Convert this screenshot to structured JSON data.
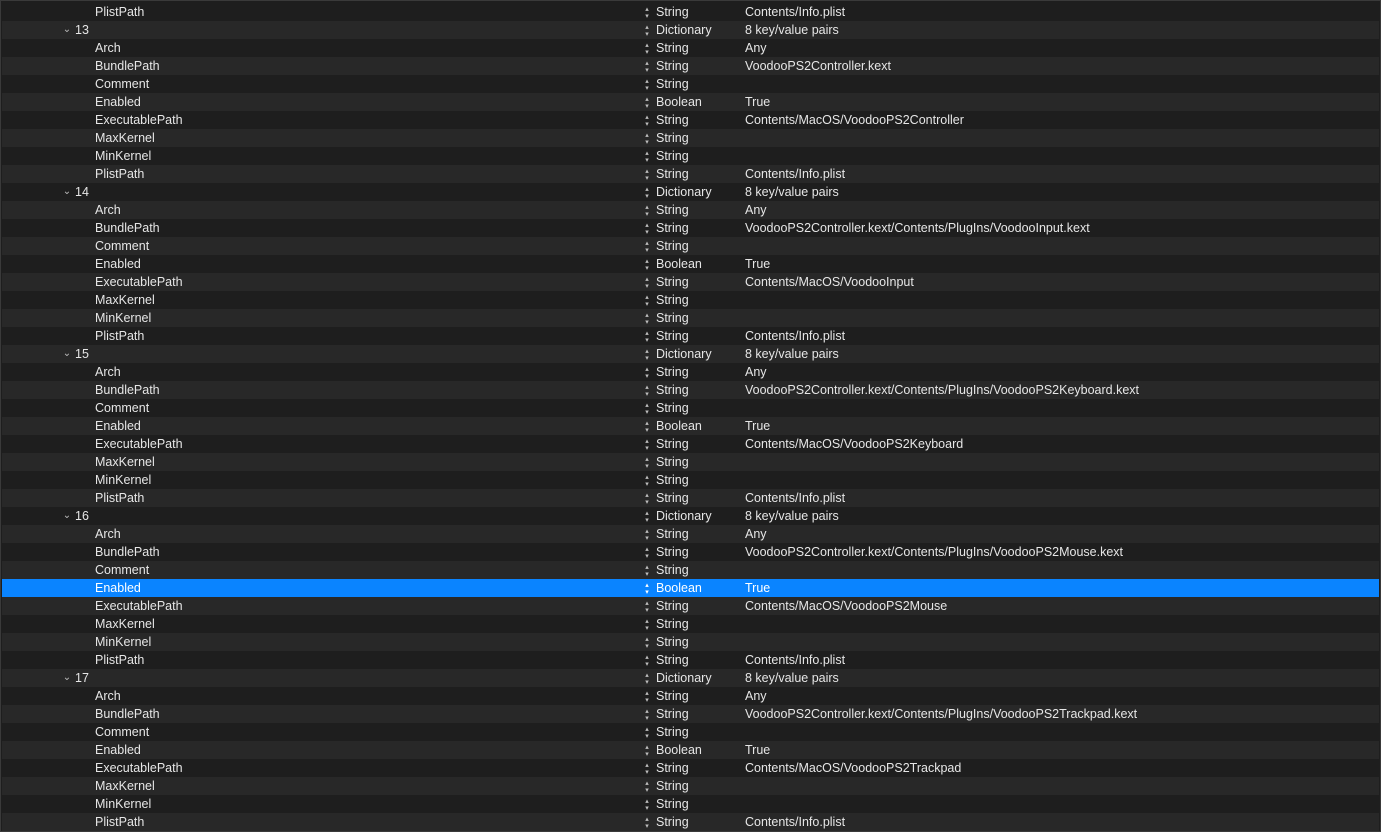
{
  "colors": {
    "background": "#1e1e1e",
    "row_alt": "#282828",
    "selection": "#0a84ff",
    "text": "#e6e6e6"
  },
  "icons": {
    "disclosure": "chevron-down-icon",
    "stepper": "up-down-stepper-icon"
  },
  "rows": [
    {
      "level": 2,
      "key": "PlistPath",
      "type": "String",
      "value": "Contents/Info.plist"
    },
    {
      "level": 1,
      "key": "13",
      "type": "Dictionary",
      "value": "8 key/value pairs",
      "expanded": true
    },
    {
      "level": 2,
      "key": "Arch",
      "type": "String",
      "value": "Any"
    },
    {
      "level": 2,
      "key": "BundlePath",
      "type": "String",
      "value": "VoodooPS2Controller.kext"
    },
    {
      "level": 2,
      "key": "Comment",
      "type": "String",
      "value": ""
    },
    {
      "level": 2,
      "key": "Enabled",
      "type": "Boolean",
      "value": "True"
    },
    {
      "level": 2,
      "key": "ExecutablePath",
      "type": "String",
      "value": "Contents/MacOS/VoodooPS2Controller"
    },
    {
      "level": 2,
      "key": "MaxKernel",
      "type": "String",
      "value": ""
    },
    {
      "level": 2,
      "key": "MinKernel",
      "type": "String",
      "value": ""
    },
    {
      "level": 2,
      "key": "PlistPath",
      "type": "String",
      "value": "Contents/Info.plist"
    },
    {
      "level": 1,
      "key": "14",
      "type": "Dictionary",
      "value": "8 key/value pairs",
      "expanded": true
    },
    {
      "level": 2,
      "key": "Arch",
      "type": "String",
      "value": "Any"
    },
    {
      "level": 2,
      "key": "BundlePath",
      "type": "String",
      "value": "VoodooPS2Controller.kext/Contents/PlugIns/VoodooInput.kext"
    },
    {
      "level": 2,
      "key": "Comment",
      "type": "String",
      "value": ""
    },
    {
      "level": 2,
      "key": "Enabled",
      "type": "Boolean",
      "value": "True"
    },
    {
      "level": 2,
      "key": "ExecutablePath",
      "type": "String",
      "value": "Contents/MacOS/VoodooInput"
    },
    {
      "level": 2,
      "key": "MaxKernel",
      "type": "String",
      "value": ""
    },
    {
      "level": 2,
      "key": "MinKernel",
      "type": "String",
      "value": ""
    },
    {
      "level": 2,
      "key": "PlistPath",
      "type": "String",
      "value": "Contents/Info.plist"
    },
    {
      "level": 1,
      "key": "15",
      "type": "Dictionary",
      "value": "8 key/value pairs",
      "expanded": true
    },
    {
      "level": 2,
      "key": "Arch",
      "type": "String",
      "value": "Any"
    },
    {
      "level": 2,
      "key": "BundlePath",
      "type": "String",
      "value": "VoodooPS2Controller.kext/Contents/PlugIns/VoodooPS2Keyboard.kext"
    },
    {
      "level": 2,
      "key": "Comment",
      "type": "String",
      "value": ""
    },
    {
      "level": 2,
      "key": "Enabled",
      "type": "Boolean",
      "value": "True"
    },
    {
      "level": 2,
      "key": "ExecutablePath",
      "type": "String",
      "value": "Contents/MacOS/VoodooPS2Keyboard"
    },
    {
      "level": 2,
      "key": "MaxKernel",
      "type": "String",
      "value": ""
    },
    {
      "level": 2,
      "key": "MinKernel",
      "type": "String",
      "value": ""
    },
    {
      "level": 2,
      "key": "PlistPath",
      "type": "String",
      "value": "Contents/Info.plist"
    },
    {
      "level": 1,
      "key": "16",
      "type": "Dictionary",
      "value": "8 key/value pairs",
      "expanded": true
    },
    {
      "level": 2,
      "key": "Arch",
      "type": "String",
      "value": "Any"
    },
    {
      "level": 2,
      "key": "BundlePath",
      "type": "String",
      "value": "VoodooPS2Controller.kext/Contents/PlugIns/VoodooPS2Mouse.kext"
    },
    {
      "level": 2,
      "key": "Comment",
      "type": "String",
      "value": ""
    },
    {
      "level": 2,
      "key": "Enabled",
      "type": "Boolean",
      "value": "True",
      "selected": true
    },
    {
      "level": 2,
      "key": "ExecutablePath",
      "type": "String",
      "value": "Contents/MacOS/VoodooPS2Mouse"
    },
    {
      "level": 2,
      "key": "MaxKernel",
      "type": "String",
      "value": ""
    },
    {
      "level": 2,
      "key": "MinKernel",
      "type": "String",
      "value": ""
    },
    {
      "level": 2,
      "key": "PlistPath",
      "type": "String",
      "value": "Contents/Info.plist"
    },
    {
      "level": 1,
      "key": "17",
      "type": "Dictionary",
      "value": "8 key/value pairs",
      "expanded": true
    },
    {
      "level": 2,
      "key": "Arch",
      "type": "String",
      "value": "Any"
    },
    {
      "level": 2,
      "key": "BundlePath",
      "type": "String",
      "value": "VoodooPS2Controller.kext/Contents/PlugIns/VoodooPS2Trackpad.kext"
    },
    {
      "level": 2,
      "key": "Comment",
      "type": "String",
      "value": ""
    },
    {
      "level": 2,
      "key": "Enabled",
      "type": "Boolean",
      "value": "True"
    },
    {
      "level": 2,
      "key": "ExecutablePath",
      "type": "String",
      "value": "Contents/MacOS/VoodooPS2Trackpad"
    },
    {
      "level": 2,
      "key": "MaxKernel",
      "type": "String",
      "value": ""
    },
    {
      "level": 2,
      "key": "MinKernel",
      "type": "String",
      "value": ""
    },
    {
      "level": 2,
      "key": "PlistPath",
      "type": "String",
      "value": "Contents/Info.plist"
    }
  ]
}
